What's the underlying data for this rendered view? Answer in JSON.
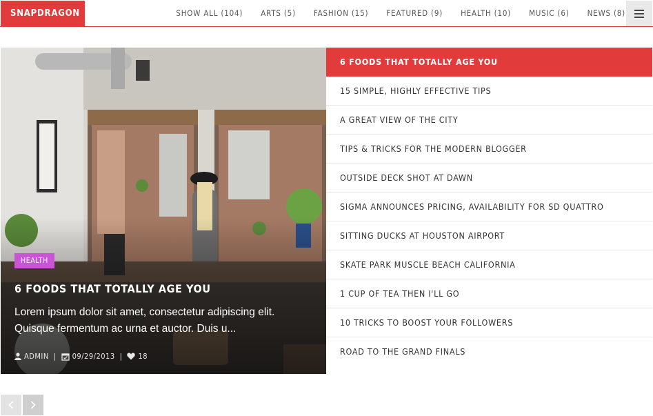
{
  "header": {
    "logo": "SNAPDRAGON",
    "nav": [
      {
        "label": "SHOW ALL (104)"
      },
      {
        "label": "ARTS (5)"
      },
      {
        "label": "FASHION (15)"
      },
      {
        "label": "FEATURED (9)"
      },
      {
        "label": "HEALTH (10)"
      },
      {
        "label": "MUSIC (6)"
      },
      {
        "label": "NEWS (8)"
      }
    ],
    "menu_icon": "hamburger-menu-icon"
  },
  "featured": {
    "category": "HEALTH",
    "title": "6 FOODS THAT TOTALLY AGE YOU",
    "excerpt": "Lorem ipsum dolor sit amet, consectetur adipiscing elit. Quisque fermentum ac urna et auctor. Duis u...",
    "author": "ADMIN",
    "date": "09/29/2013",
    "likes": "18",
    "colors": {
      "badge": "#c954d6"
    }
  },
  "post_list": [
    {
      "title": "6 FOODS THAT TOTALLY AGE YOU",
      "active": true
    },
    {
      "title": "15 SIMPLE, HIGHLY EFFECTIVE TIPS"
    },
    {
      "title": "A GREAT VIEW OF THE CITY"
    },
    {
      "title": "TIPS & TRICKS FOR THE MODERN BLOGGER"
    },
    {
      "title": "OUTSIDE DECK SHOT AT DAWN"
    },
    {
      "title": "SIGMA ANNOUNCES PRICING, AVAILABILITY FOR SD QUATTRO"
    },
    {
      "title": "SITTING DUCKS AT HOUSTON AIRPORT"
    },
    {
      "title": "SKATE PARK MUSCLE BEACH CALIFORNIA"
    },
    {
      "title": "1 CUP OF TEA THEN I'LL GO"
    },
    {
      "title": "10 TRICKS TO BOOST YOUR FOLLOWERS"
    },
    {
      "title": "ROAD TO THE GRAND FINALS"
    }
  ],
  "pager": {
    "prev_icon": "chevron-left-icon",
    "next_icon": "chevron-right-icon"
  },
  "theme": {
    "accent": "#e23b3b"
  }
}
